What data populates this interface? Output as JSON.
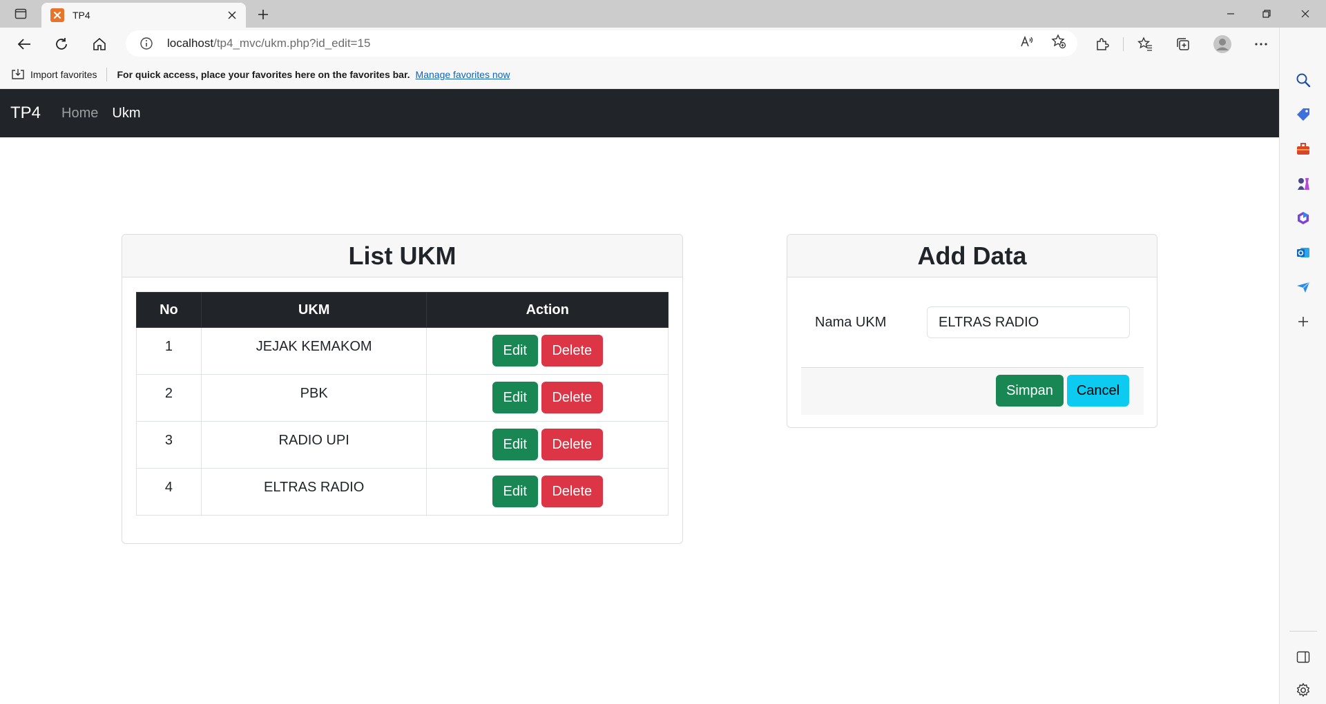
{
  "browser": {
    "tab_title": "TP4",
    "url_host": "localhost",
    "url_path": "/tp4_mvc/ukm.php?id_edit=15",
    "favorites": {
      "import_label": "Import favorites",
      "message": "For quick access, place your favorites here on the favorites bar.",
      "manage_link": "Manage favorites now"
    }
  },
  "navbar": {
    "brand": "TP4",
    "links": [
      {
        "label": "Home",
        "active": false
      },
      {
        "label": "Ukm",
        "active": true
      }
    ]
  },
  "list_card": {
    "title": "List UKM",
    "columns": [
      "No",
      "UKM",
      "Action"
    ],
    "rows": [
      {
        "no": "1",
        "name": "JEJAK KEMAKOM"
      },
      {
        "no": "2",
        "name": "PBK"
      },
      {
        "no": "3",
        "name": "RADIO UPI"
      },
      {
        "no": "4",
        "name": "ELTRAS RADIO"
      }
    ],
    "edit_label": "Edit",
    "delete_label": "Delete"
  },
  "form_card": {
    "title": "Add Data",
    "field_label": "Nama UKM",
    "field_value": "ELTRAS RADIO",
    "save_label": "Simpan",
    "cancel_label": "Cancel"
  },
  "colors": {
    "navbar": "#212529",
    "success": "#198754",
    "danger": "#dc3545",
    "info": "#0dcaf0"
  }
}
